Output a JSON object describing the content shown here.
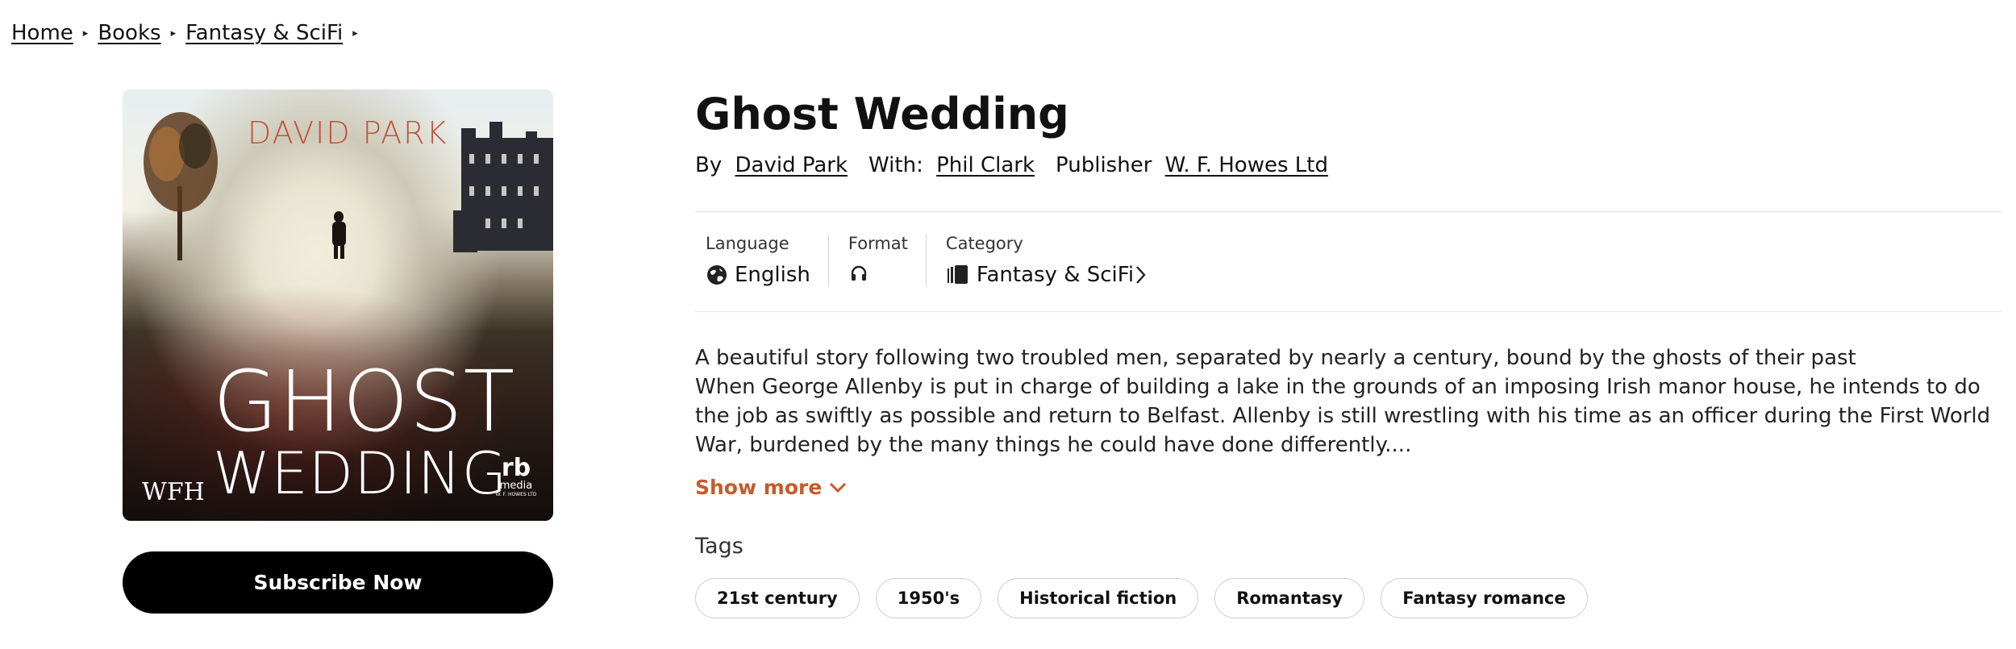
{
  "breadcrumb": {
    "items": [
      "Home",
      "Books",
      "Fantasy & SciFi"
    ],
    "separator": "▸"
  },
  "cover": {
    "author": "DAVID PARK",
    "title_line1": "GHOST",
    "title_line2": "WEDDING",
    "imprint": "WFH",
    "logo_mark": "rb",
    "logo_text": "media",
    "logo_publisher": "W. F. HOWES LTD"
  },
  "subscribe_label": "Subscribe Now",
  "book": {
    "title": "Ghost Wedding",
    "by_label": "By",
    "author": "David Park",
    "with_label": "With:",
    "narrator": "Phil Clark",
    "publisher_label": "Publisher",
    "publisher": "W. F. Howes Ltd"
  },
  "meta": {
    "language_label": "Language",
    "language_value": "English",
    "format_label": "Format",
    "category_label": "Category",
    "category_value": "Fantasy & SciFi",
    "icons": {
      "language": "globe-icon",
      "format": "headphones-icon",
      "category": "books-icon"
    }
  },
  "description": {
    "line1": "A beautiful story following two troubled men, separated by nearly a century, bound by the ghosts of their past",
    "body": "When George Allenby is put in charge of building a lake in the grounds of an imposing Irish manor house, he intends to do the job as swiftly as possible and return to Belfast. Allenby is still wrestling with his time as an officer during the First World War, burdened by the many things he could have done differently...."
  },
  "show_more": "Show more",
  "tags": {
    "label": "Tags",
    "items": [
      "21st century",
      "1950's",
      "Historical fiction",
      "Romantasy",
      "Fantasy romance"
    ]
  },
  "colors": {
    "accent": "#c75a2a",
    "button_bg": "#000000",
    "cover_author": "#c0533b"
  }
}
